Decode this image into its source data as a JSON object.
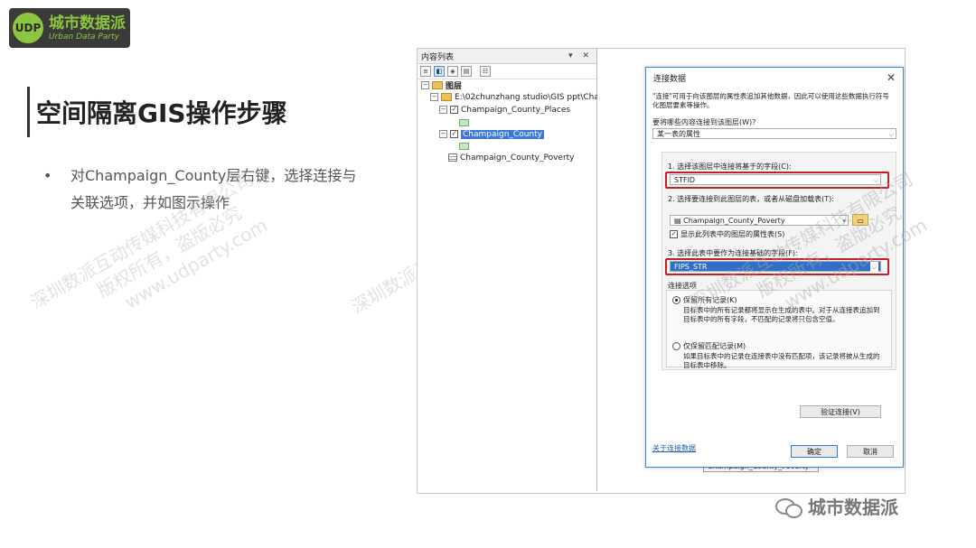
{
  "logo": {
    "mark": "UDP",
    "cn": "城市数据派",
    "en": "Urban Data Party"
  },
  "slide": {
    "title": "空间隔离GIS操作步骤",
    "bullet": "对Champaign_County层右键，选择连接与关联选项，并如图示操作"
  },
  "watermarks": [
    {
      "line1": "深圳数派互动传媒科技有限公司",
      "line2": "版权所有，盗版必究",
      "line3": "www.udparty.com"
    },
    {
      "line1": "深圳数派互动传媒科技有限公司",
      "line2": "版权所有，盗版必究",
      "line3": "www.udparty.com"
    },
    {
      "line1": "深圳数派互动传媒科技有限公司",
      "line2": "版权所有，盗版必究",
      "line3": "www.udparty.com"
    }
  ],
  "toc": {
    "title": "内容列表",
    "controls": "▾ ✕",
    "tools": [
      "≡",
      "◧",
      "◈",
      "▤",
      "☷"
    ],
    "root": "图层",
    "folder_path": "E:\\02chunzhang studio\\GIS ppt\\Chap",
    "layers": [
      "Champaign_County_Places",
      "Champaign_County"
    ],
    "table": "Champaign_County_Poverty"
  },
  "map": {
    "label": "Champaign_County_Poverty"
  },
  "dialog": {
    "title": "连接数据",
    "close": "✕",
    "description": "\"连接\"可用于向该图层的属性表追加其他数据，因此可以使用这些数据执行符号化图层要素等操作。",
    "question": "要将哪些内容连接到该图层(W)?",
    "join_type": "某一表的属性",
    "step1_label": "1. 选择该图层中连接将基于的字段(C):",
    "step1_value": "STFID",
    "step2_label": "2. 选择要连接到此图层的表，或者从磁盘加载表(T):",
    "step2_value": "Champaign_County_Poverty",
    "show_attr_tables": "显示此列表中的图层的属性表(S)",
    "step3_label": "3. 选择此表中要作为连接基础的字段(F):",
    "step3_value": "FIPS_STR",
    "options_title": "连接选项",
    "keep_all": "保留所有记录(K)",
    "keep_all_desc": "目标表中的所有记录都将显示在生成的表中。对于从连接表追加到目标表中的所有字段，不匹配的记录将只包含空值。",
    "keep_matching": "仅保留匹配记录(M)",
    "keep_matching_desc": "如果目标表中的记录在连接表中没有匹配项，该记录将被从生成的目标表中移除。",
    "validate": "验证连接(V)",
    "about": "关于连接数据",
    "ok": "确定",
    "cancel": "取消"
  },
  "footer": {
    "text": "城市数据派"
  }
}
